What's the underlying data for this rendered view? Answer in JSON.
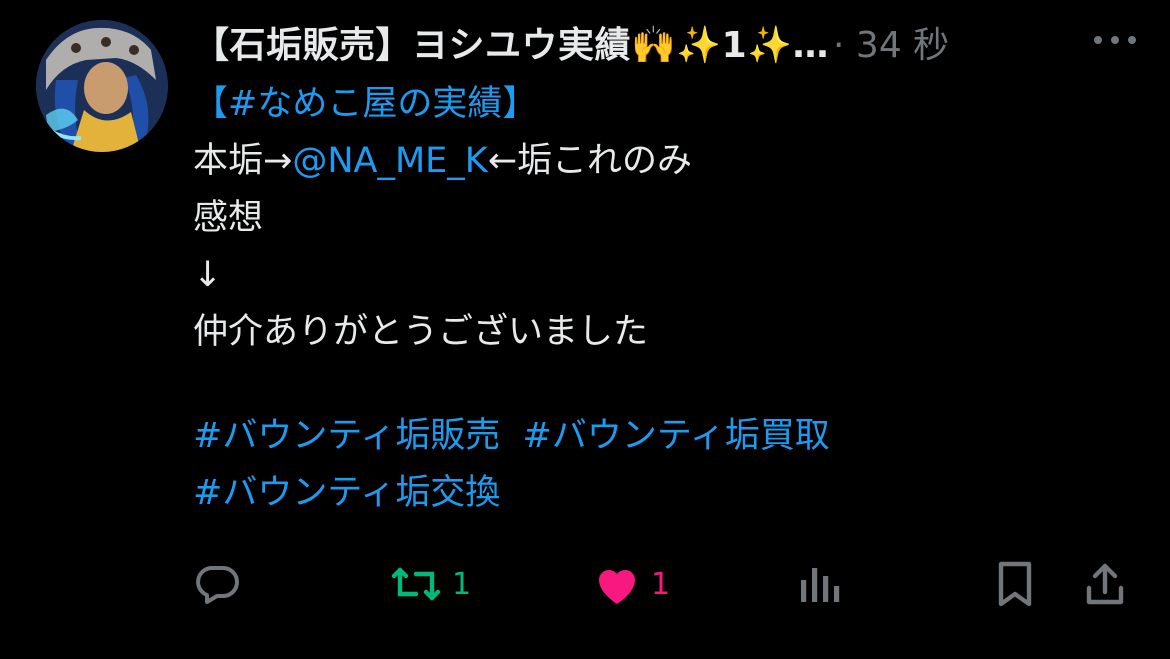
{
  "tweet": {
    "display_name": "【石垢販売】ヨシユウ実績🙌✨1✨…",
    "time": "· 34 秒",
    "lines": {
      "l1_link": "【#なめこ屋の実績】",
      "l2_pre": "本垢→",
      "l2_mention": "@NA_ME_K",
      "l2_post": "←垢これのみ",
      "l3": "感想",
      "l4": "↓",
      "l5": "仲介ありがとうございました",
      "h1": "#バウンティ垢販売",
      "h2": "#バウンティ垢買取",
      "h3": "#バウンティ垢交換"
    }
  },
  "actions": {
    "retweet_count": "1",
    "like_count": "1"
  },
  "colors": {
    "background": "#000000",
    "text": "#e7e9ea",
    "muted": "#71767b",
    "link": "#1d9bf0",
    "retweet_active": "#00ba7c",
    "like_active": "#f91880"
  },
  "icons": [
    "avatar",
    "more-icon",
    "reply-icon",
    "retweet-icon",
    "like-icon",
    "views-icon",
    "bookmark-icon",
    "share-icon"
  ]
}
